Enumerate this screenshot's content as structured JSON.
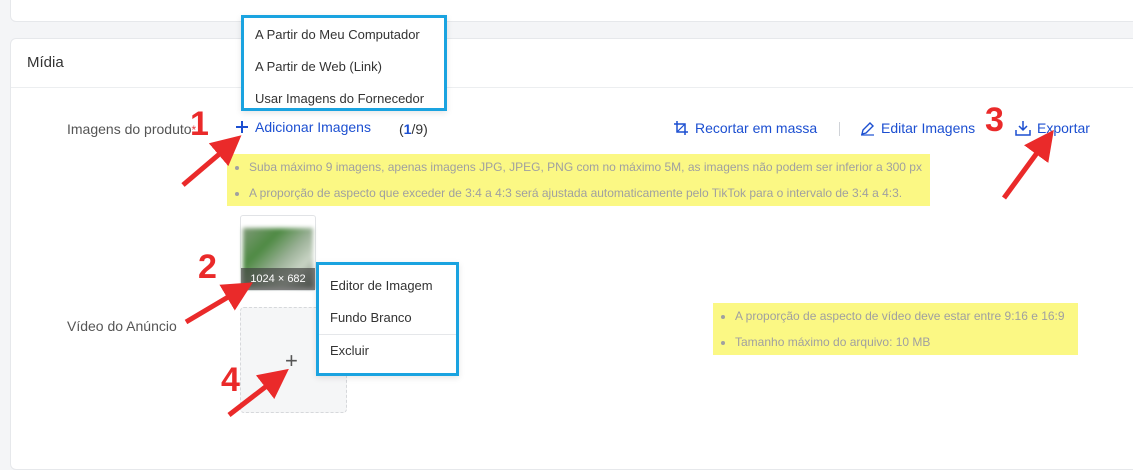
{
  "media": {
    "title": "Mídia",
    "product_images_label": "Imagens do produto",
    "required_mark": "*",
    "add_images_label": "Adicionar Imagens",
    "count_current": "1",
    "count_total": "/9)",
    "count_open": "(",
    "bulk_crop_label": "Recortar em massa",
    "edit_images_label": "Editar Imagens",
    "export_label": "Exportar",
    "image_notes": [
      "Suba máximo 9 imagens, apenas imagens JPG, JPEG, PNG com no máximo 5M, as imagens não podem ser inferior a 300 px",
      "A proporção de aspecto que exceder de 3:4 a 4:3 será ajustada automaticamente pelo TikTok para o intervalo de 3:4 a 4:3."
    ],
    "thumbnail_dimensions": "1024 × 682",
    "video_label": "Vídeo do Anúncio",
    "video_notes": [
      "A proporção de aspecto de vídeo deve estar entre 9:16 e 16:9",
      "Tamanho máximo do arquivo: 10 MB"
    ]
  },
  "add_images_menu": [
    "A Partir do Meu Computador",
    "A Partir de Web (Link)",
    "Usar Imagens do Fornecedor"
  ],
  "image_actions_menu": [
    "Editor de Imagem",
    "Fundo Branco",
    "Excluir"
  ],
  "annotations": [
    "1",
    "2",
    "3",
    "4"
  ],
  "colors": {
    "accent": "#1c4fd1",
    "highlight": "#fbf884",
    "callout_border": "#1aa3e0",
    "annotation_red": "#ea2a2a"
  }
}
